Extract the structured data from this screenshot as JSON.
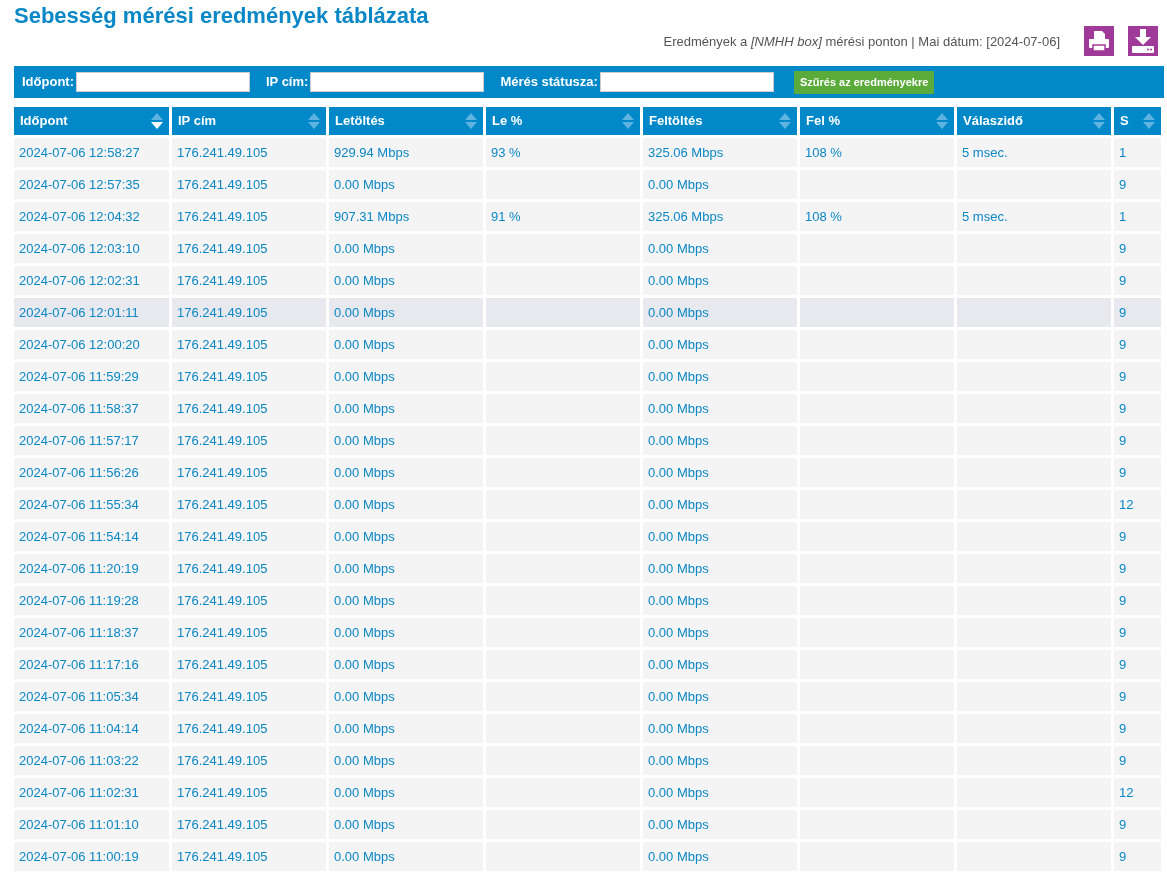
{
  "title": "Sebesség mérési eredmények táblázata",
  "subtitle": "Eredmények a *[NMHH box]* mérési ponton | Mai dátum: [2024-07-06]",
  "filters": [
    {
      "label": "Időpont:"
    },
    {
      "label": "IP cím:"
    },
    {
      "label": "Mérés státusza:"
    }
  ],
  "filter_button": "Szűrés az eredményekre",
  "table": {
    "columns": [
      {
        "label": "Időpont",
        "sorted": true
      },
      {
        "label": "IP cím",
        "sorted": false
      },
      {
        "label": "Letöltés",
        "sorted": false
      },
      {
        "label": "Le %",
        "sorted": false
      },
      {
        "label": "Feltöltés",
        "sorted": false
      },
      {
        "label": "Fel %",
        "sorted": false
      },
      {
        "label": "Válaszidő",
        "sorted": false
      },
      {
        "label": "S",
        "sorted": false
      }
    ],
    "rows": [
      {
        "selected": false,
        "cells": [
          "2024-07-06 12:58:27",
          "176.241.49.105",
          "929.94 Mbps",
          "93 %",
          "325.06 Mbps",
          "108 %",
          "5 msec.",
          "1"
        ]
      },
      {
        "selected": false,
        "cells": [
          "2024-07-06 12:57:35",
          "176.241.49.105",
          "0.00 Mbps",
          "",
          "0.00 Mbps",
          "",
          "",
          "9"
        ]
      },
      {
        "selected": false,
        "cells": [
          "2024-07-06 12:04:32",
          "176.241.49.105",
          "907.31 Mbps",
          "91 %",
          "325.06 Mbps",
          "108 %",
          "5 msec.",
          "1"
        ]
      },
      {
        "selected": false,
        "cells": [
          "2024-07-06 12:03:10",
          "176.241.49.105",
          "0.00 Mbps",
          "",
          "0.00 Mbps",
          "",
          "",
          "9"
        ]
      },
      {
        "selected": false,
        "cells": [
          "2024-07-06 12:02:31",
          "176.241.49.105",
          "0.00 Mbps",
          "",
          "0.00 Mbps",
          "",
          "",
          "9"
        ]
      },
      {
        "selected": true,
        "cells": [
          "2024-07-06 12:01:11",
          "176.241.49.105",
          "0.00 Mbps",
          "",
          "0.00 Mbps",
          "",
          "",
          "9"
        ]
      },
      {
        "selected": false,
        "cells": [
          "2024-07-06 12:00:20",
          "176.241.49.105",
          "0.00 Mbps",
          "",
          "0.00 Mbps",
          "",
          "",
          "9"
        ]
      },
      {
        "selected": false,
        "cells": [
          "2024-07-06 11:59:29",
          "176.241.49.105",
          "0.00 Mbps",
          "",
          "0.00 Mbps",
          "",
          "",
          "9"
        ]
      },
      {
        "selected": false,
        "cells": [
          "2024-07-06 11:58:37",
          "176.241.49.105",
          "0.00 Mbps",
          "",
          "0.00 Mbps",
          "",
          "",
          "9"
        ]
      },
      {
        "selected": false,
        "cells": [
          "2024-07-06 11:57:17",
          "176.241.49.105",
          "0.00 Mbps",
          "",
          "0.00 Mbps",
          "",
          "",
          "9"
        ]
      },
      {
        "selected": false,
        "cells": [
          "2024-07-06 11:56:26",
          "176.241.49.105",
          "0.00 Mbps",
          "",
          "0.00 Mbps",
          "",
          "",
          "9"
        ]
      },
      {
        "selected": false,
        "cells": [
          "2024-07-06 11:55:34",
          "176.241.49.105",
          "0.00 Mbps",
          "",
          "0.00 Mbps",
          "",
          "",
          "12"
        ]
      },
      {
        "selected": false,
        "cells": [
          "2024-07-06 11:54:14",
          "176.241.49.105",
          "0.00 Mbps",
          "",
          "0.00 Mbps",
          "",
          "",
          "9"
        ]
      },
      {
        "selected": false,
        "cells": [
          "2024-07-06 11:20:19",
          "176.241.49.105",
          "0.00 Mbps",
          "",
          "0.00 Mbps",
          "",
          "",
          "9"
        ]
      },
      {
        "selected": false,
        "cells": [
          "2024-07-06 11:19:28",
          "176.241.49.105",
          "0.00 Mbps",
          "",
          "0.00 Mbps",
          "",
          "",
          "9"
        ]
      },
      {
        "selected": false,
        "cells": [
          "2024-07-06 11:18:37",
          "176.241.49.105",
          "0.00 Mbps",
          "",
          "0.00 Mbps",
          "",
          "",
          "9"
        ]
      },
      {
        "selected": false,
        "cells": [
          "2024-07-06 11:17:16",
          "176.241.49.105",
          "0.00 Mbps",
          "",
          "0.00 Mbps",
          "",
          "",
          "9"
        ]
      },
      {
        "selected": false,
        "cells": [
          "2024-07-06 11:05:34",
          "176.241.49.105",
          "0.00 Mbps",
          "",
          "0.00 Mbps",
          "",
          "",
          "9"
        ]
      },
      {
        "selected": false,
        "cells": [
          "2024-07-06 11:04:14",
          "176.241.49.105",
          "0.00 Mbps",
          "",
          "0.00 Mbps",
          "",
          "",
          "9"
        ]
      },
      {
        "selected": false,
        "cells": [
          "2024-07-06 11:03:22",
          "176.241.49.105",
          "0.00 Mbps",
          "",
          "0.00 Mbps",
          "",
          "",
          "9"
        ]
      },
      {
        "selected": false,
        "cells": [
          "2024-07-06 11:02:31",
          "176.241.49.105",
          "0.00 Mbps",
          "",
          "0.00 Mbps",
          "",
          "",
          "12"
        ]
      },
      {
        "selected": false,
        "cells": [
          "2024-07-06 11:01:10",
          "176.241.49.105",
          "0.00 Mbps",
          "",
          "0.00 Mbps",
          "",
          "",
          "9"
        ]
      },
      {
        "selected": false,
        "cells": [
          "2024-07-06 11:00:19",
          "176.241.49.105",
          "0.00 Mbps",
          "",
          "0.00 Mbps",
          "",
          "",
          "9"
        ]
      }
    ]
  }
}
